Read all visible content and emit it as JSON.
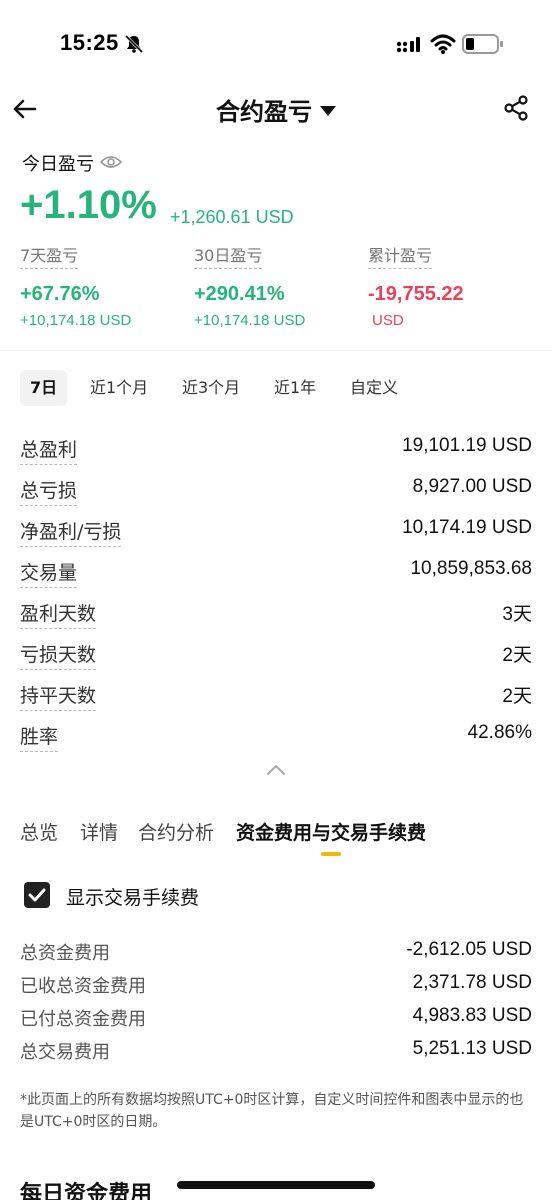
{
  "status_bar": {
    "time": "15:25"
  },
  "nav": {
    "title": "合约盈亏"
  },
  "today": {
    "label": "今日盈亏",
    "pct": "+1.10%",
    "usd": "+1,260.61 USD"
  },
  "stats": [
    {
      "label": "7天盈亏",
      "pct": "+67.76%",
      "sub": "+10,174.18 USD",
      "tone": "green"
    },
    {
      "label": "30日盈亏",
      "pct": "+290.41%",
      "sub": "+10,174.18 USD",
      "tone": "green"
    },
    {
      "label": "累计盈亏",
      "pct": "-19,755.22",
      "sub": "USD",
      "tone": "red"
    }
  ],
  "periods": [
    "7日",
    "近1个月",
    "近3个月",
    "近1年",
    "自定义"
  ],
  "summary": [
    {
      "k": "总盈利",
      "v": "19,101.19 USD"
    },
    {
      "k": "总亏损",
      "v": "8,927.00 USD"
    },
    {
      "k": "净盈利/亏损",
      "v": "10,174.19 USD"
    },
    {
      "k": "交易量",
      "v": "10,859,853.68"
    },
    {
      "k": "盈利天数",
      "v": "3天"
    },
    {
      "k": "亏损天数",
      "v": "2天"
    },
    {
      "k": "持平天数",
      "v": "2天"
    },
    {
      "k": "胜率",
      "v": "42.86%"
    }
  ],
  "section_tabs": [
    "总览",
    "详情",
    "合约分析",
    "资金费用与交易手续费"
  ],
  "checkbox_label": "显示交易手续费",
  "fees": [
    {
      "k": "总资金费用",
      "v": "-2,612.05 USD"
    },
    {
      "k": "已收总资金费用",
      "v": "2,371.78 USD"
    },
    {
      "k": "已付总资金费用",
      "v": "4,983.83 USD"
    },
    {
      "k": "总交易费用",
      "v": "5,251.13 USD"
    }
  ],
  "footnote": "*此页面上的所有数据均按照UTC+0时区计算，自定义时间控件和图表中显示的也是UTC+0时区的日期。",
  "daily_heading": "每日资金费用",
  "colors": {
    "green": "#27b47c",
    "red": "#e8435a",
    "accent": "#f0b90b"
  }
}
